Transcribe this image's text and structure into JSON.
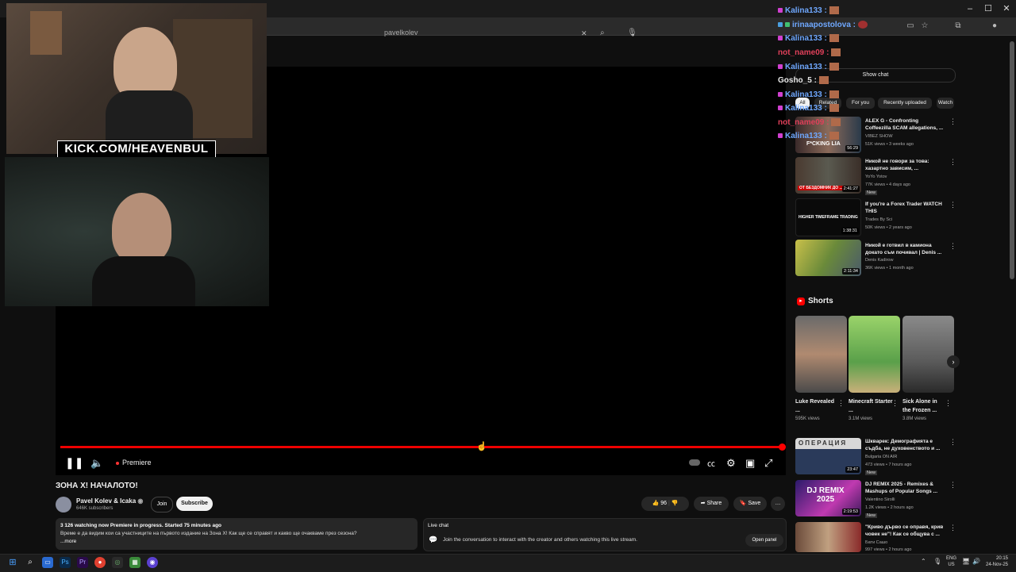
{
  "browser": {
    "search_text": "pavelkolev",
    "win_minimize": "–",
    "win_maximize": "☐",
    "win_close": "✕"
  },
  "stream_overlay": {
    "kick_banner": "KICK.COM/HEAVENBUL"
  },
  "chat_overlay": [
    {
      "user": "Kalina133 :",
      "color": "#6fa8ff"
    },
    {
      "user": "irinaapostolova :",
      "color": "#6fa8ff"
    },
    {
      "user": "Kalina133 :",
      "color": "#6fa8ff"
    },
    {
      "user": "not_name09 :",
      "color": "#e0405a"
    },
    {
      "user": "Kalina133 :",
      "color": "#6fa8ff"
    },
    {
      "user": "Gosho_5 :",
      "color": "#e8e8e8"
    },
    {
      "user": "Kalina133 :",
      "color": "#6fa8ff"
    },
    {
      "user": "Kalina133 :",
      "color": "#6fa8ff"
    },
    {
      "user": "not_name09 :",
      "color": "#e0405a"
    },
    {
      "user": "Kalina133 :",
      "color": "#6fa8ff"
    }
  ],
  "player": {
    "status_label": "Premiere",
    "progress": 1.0
  },
  "video": {
    "title": "ЗОНА Х! НАЧАЛОТО!",
    "channel": "Pavel Kolev & Icaka",
    "subscribers": "646K subscribers",
    "join_label": "Join",
    "subscribe_label": "Subscribe",
    "likes": "96",
    "share_label": "Share",
    "save_label": "Save",
    "more_label": "…"
  },
  "description": {
    "stats": "3 126 watching now  Premiere in progress. Started 75 minutes ago",
    "text": "Време е да видим кои са участниците на първото издание на Зона Х! Как ще се справят и какво ще очакваме през сезона?",
    "more": "...more"
  },
  "live_chat": {
    "heading": "Live chat",
    "prompt": "Join the conversation to interact with the creator and others watching this live stream.",
    "open_panel": "Open panel"
  },
  "sidebar": {
    "show_chat": "Show chat",
    "chips": [
      "All",
      "Related",
      "For you",
      "Recently uploaded",
      "Watch"
    ],
    "videos_top": [
      {
        "title": "ALEX G - Confronting Coffeezilla SCAM allegations, ...",
        "channel": "VIBEZ SHOW",
        "meta": "51K views • 3 weeks ago",
        "duration": "56:29",
        "badge": "",
        "thumb_overlay": "F*CKING LIA"
      },
      {
        "title": "Никой не говори за това: хазартно зависим, ...",
        "channel": "YoYo Yotov",
        "meta": "77K views • 4 days ago",
        "duration": "2:41:27",
        "badge": "New",
        "thumb_overlay": "ОТ БЕЗДОМНИК ДО ..."
      },
      {
        "title": "If you're a Forex Trader WATCH THIS",
        "channel": "Trades By Sci",
        "meta": "50K views • 2 years ago",
        "duration": "1:38:31",
        "badge": "",
        "thumb_overlay": "HIGHER TIMEFRAME TRADING"
      },
      {
        "title": "Никой е готвил в камиона докато съм почивал | Denis ...",
        "channel": "Denis Kadirow",
        "meta": "36K views • 1 month ago",
        "duration": "2:11:34",
        "badge": "",
        "thumb_overlay": ""
      }
    ],
    "shorts_heading": "Shorts",
    "shorts": [
      {
        "title": "Luke Revealed ...",
        "views": "595K views"
      },
      {
        "title": "Minecraft Starter ...",
        "views": "3.1M views"
      },
      {
        "title": "Sick Alone in the Frozen ...",
        "views": "3.8M views"
      }
    ],
    "videos_bottom": [
      {
        "title": "Шкварек: Демографията е съдба, не духовенството и ...",
        "channel": "Bulgaria ON AIR",
        "meta": "473 views • 7 hours ago",
        "duration": "23:47",
        "badge": "New",
        "thumb_overlay": "ОПЕРАЦИЯ"
      },
      {
        "title": "DJ REMIX 2025 - Remixes & Mashups of Popular Songs ...",
        "channel": "Valentino Sirolli",
        "meta": "1.2K views • 2 hours ago",
        "duration": "2:19:53",
        "badge": "New",
        "thumb_overlay": "DJ REMIX 2025"
      },
      {
        "title": "\"Криво дърво се оправя, крив човек не\"! Как се общува с ...",
        "channel": "Бати Сашо",
        "meta": "997 views • 2 hours ago",
        "duration": "",
        "badge": "",
        "thumb_overlay": ""
      }
    ]
  },
  "taskbar": {
    "lang": "ENG",
    "region": "US",
    "time": "20:15",
    "date": "24-Nov-25"
  },
  "colors": {
    "accent": "#ff0000",
    "background": "#0f0f0f"
  }
}
